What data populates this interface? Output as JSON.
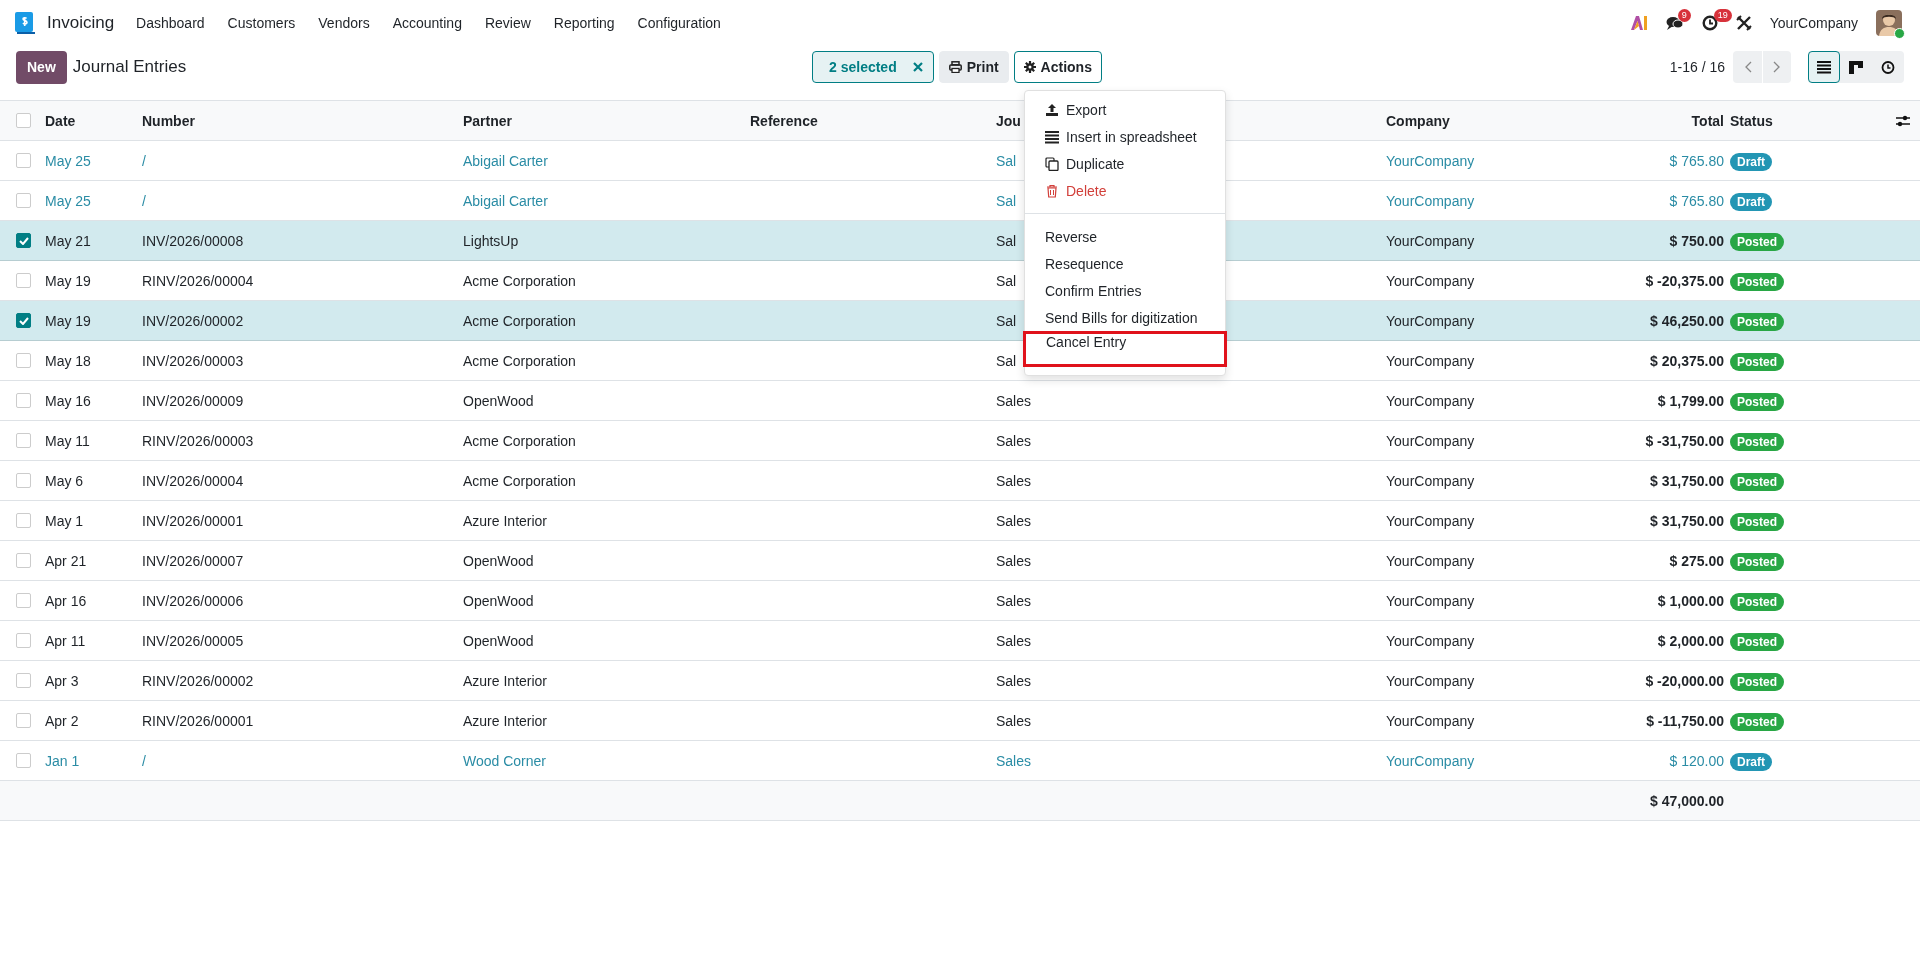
{
  "navbar": {
    "app_name": "Invoicing",
    "menu": [
      "Dashboard",
      "Customers",
      "Vendors",
      "Accounting",
      "Review",
      "Reporting",
      "Configuration"
    ],
    "systray": {
      "messages_badge": "9",
      "activities_badge": "19",
      "company": "YourCompany",
      "online": true
    }
  },
  "control_panel": {
    "new_button": "New",
    "title": "Journal Entries",
    "selection": "2 selected",
    "print": "Print",
    "actions": "Actions",
    "pager": "1-16 / 16",
    "views": [
      {
        "kind": "list",
        "selected": true
      },
      {
        "kind": "kanban",
        "selected": false
      },
      {
        "kind": "activity",
        "selected": false
      }
    ]
  },
  "actions_menu": {
    "groups": [
      [
        {
          "label": "Export",
          "kind": "export",
          "danger": false,
          "highlighted": false
        },
        {
          "label": "Insert in spreadsheet",
          "kind": "spreadsheet",
          "danger": false,
          "highlighted": false
        },
        {
          "label": "Duplicate",
          "kind": "duplicate",
          "danger": false,
          "highlighted": false
        },
        {
          "label": "Delete",
          "kind": "delete",
          "danger": true,
          "highlighted": false
        }
      ],
      [
        {
          "label": "Reverse",
          "kind": "plain",
          "danger": false,
          "highlighted": false
        },
        {
          "label": "Resequence",
          "kind": "plain",
          "danger": false,
          "highlighted": false
        },
        {
          "label": "Confirm Entries",
          "kind": "plain",
          "danger": false,
          "highlighted": false
        },
        {
          "label": "Send Bills for digitization",
          "kind": "plain",
          "danger": false,
          "highlighted": false
        },
        {
          "label": "Cancel Entry",
          "kind": "plain",
          "danger": false,
          "highlighted": true
        }
      ]
    ]
  },
  "table": {
    "header_checked": false,
    "columns": [
      "Date",
      "Number",
      "Partner",
      "Reference",
      "Jou",
      "Company",
      "Total",
      "Status"
    ],
    "rows": [
      {
        "selected": false,
        "kind": "draft",
        "date": "May 25",
        "number": "/",
        "partner": "Abigail Carter",
        "journal": "Sal",
        "company": "YourCompany",
        "total": "$ 765.80",
        "status": "Draft"
      },
      {
        "selected": false,
        "kind": "draft",
        "date": "May 25",
        "number": "/",
        "partner": "Abigail Carter",
        "journal": "Sal",
        "company": "YourCompany",
        "total": "$ 765.80",
        "status": "Draft"
      },
      {
        "selected": true,
        "kind": "posted",
        "date": "May 21",
        "number": "INV/2026/00008",
        "partner": "LightsUp",
        "journal": "Sal",
        "company": "YourCompany",
        "total": "$ 750.00",
        "status": "Posted"
      },
      {
        "selected": false,
        "kind": "posted",
        "date": "May 19",
        "number": "RINV/2026/00004",
        "partner": "Acme Corporation",
        "journal": "Sal",
        "company": "YourCompany",
        "total": "$ -20,375.00",
        "status": "Posted"
      },
      {
        "selected": true,
        "kind": "posted",
        "date": "May 19",
        "number": "INV/2026/00002",
        "partner": "Acme Corporation",
        "journal": "Sal",
        "company": "YourCompany",
        "total": "$ 46,250.00",
        "status": "Posted"
      },
      {
        "selected": false,
        "kind": "posted",
        "date": "May 18",
        "number": "INV/2026/00003",
        "partner": "Acme Corporation",
        "journal": "Sal",
        "company": "YourCompany",
        "total": "$ 20,375.00",
        "status": "Posted"
      },
      {
        "selected": false,
        "kind": "posted",
        "date": "May 16",
        "number": "INV/2026/00009",
        "partner": "OpenWood",
        "journal": "Sales",
        "company": "YourCompany",
        "total": "$ 1,799.00",
        "status": "Posted"
      },
      {
        "selected": false,
        "kind": "posted",
        "date": "May 11",
        "number": "RINV/2026/00003",
        "partner": "Acme Corporation",
        "journal": "Sales",
        "company": "YourCompany",
        "total": "$ -31,750.00",
        "status": "Posted"
      },
      {
        "selected": false,
        "kind": "posted",
        "date": "May 6",
        "number": "INV/2026/00004",
        "partner": "Acme Corporation",
        "journal": "Sales",
        "company": "YourCompany",
        "total": "$ 31,750.00",
        "status": "Posted"
      },
      {
        "selected": false,
        "kind": "posted",
        "date": "May 1",
        "number": "INV/2026/00001",
        "partner": "Azure Interior",
        "journal": "Sales",
        "company": "YourCompany",
        "total": "$ 31,750.00",
        "status": "Posted"
      },
      {
        "selected": false,
        "kind": "posted",
        "date": "Apr 21",
        "number": "INV/2026/00007",
        "partner": "OpenWood",
        "journal": "Sales",
        "company": "YourCompany",
        "total": "$ 275.00",
        "status": "Posted"
      },
      {
        "selected": false,
        "kind": "posted",
        "date": "Apr 16",
        "number": "INV/2026/00006",
        "partner": "OpenWood",
        "journal": "Sales",
        "company": "YourCompany",
        "total": "$ 1,000.00",
        "status": "Posted"
      },
      {
        "selected": false,
        "kind": "posted",
        "date": "Apr 11",
        "number": "INV/2026/00005",
        "partner": "OpenWood",
        "journal": "Sales",
        "company": "YourCompany",
        "total": "$ 2,000.00",
        "status": "Posted"
      },
      {
        "selected": false,
        "kind": "posted",
        "date": "Apr 3",
        "number": "RINV/2026/00002",
        "partner": "Azure Interior",
        "journal": "Sales",
        "company": "YourCompany",
        "total": "$ -20,000.00",
        "status": "Posted"
      },
      {
        "selected": false,
        "kind": "posted",
        "date": "Apr 2",
        "number": "RINV/2026/00001",
        "partner": "Azure Interior",
        "journal": "Sales",
        "company": "YourCompany",
        "total": "$ -11,750.00",
        "status": "Posted"
      },
      {
        "selected": false,
        "kind": "draft",
        "date": "Jan 1",
        "number": "/",
        "partner": "Wood Corner",
        "journal": "Sales",
        "company": "YourCompany",
        "total": "$ 120.00",
        "status": "Draft"
      }
    ],
    "footer_total": "$ 47,000.00"
  }
}
